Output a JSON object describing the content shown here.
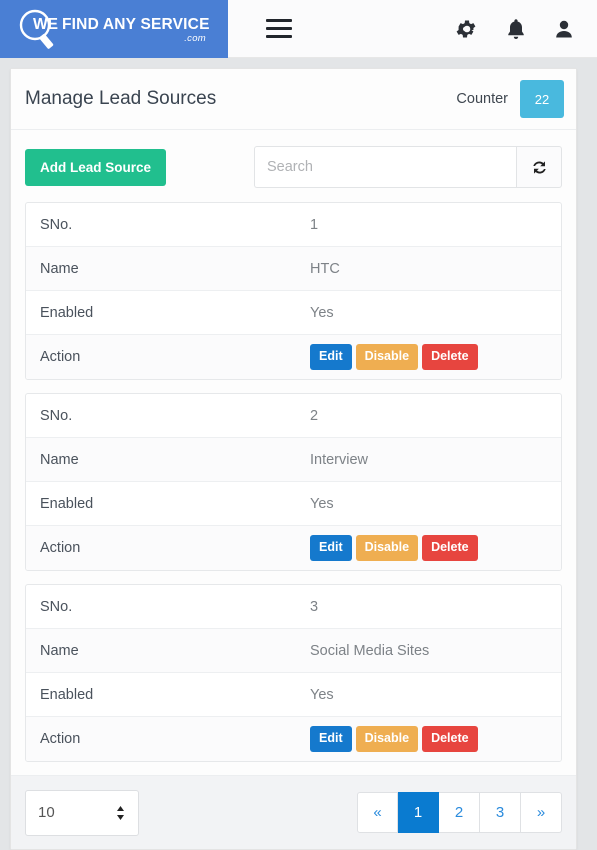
{
  "navbar": {
    "brand": {
      "we": "WE",
      "text": "FIND ANY SERVICE",
      "dotcom": ".com",
      "logo_icon": "magnifier-icon"
    },
    "menu_toggle_icon": "hamburger-icon",
    "icons": [
      {
        "name": "gear-icon",
        "label": "Settings"
      },
      {
        "name": "bell-icon",
        "label": "Notifications"
      },
      {
        "name": "user-icon",
        "label": "Account"
      }
    ]
  },
  "header": {
    "title": "Manage Lead Sources",
    "counter_label": "Counter",
    "counter_value": "22",
    "counter_color": "#49b9de"
  },
  "toolbar": {
    "add_label": "Add Lead Source",
    "add_color": "#21bf8e",
    "search_value": "",
    "search_placeholder": "Search",
    "refresh_icon": "refresh-icon"
  },
  "record_labels": {
    "sno": "SNo.",
    "name": "Name",
    "enabled": "Enabled",
    "action": "Action"
  },
  "actions": {
    "edit": "Edit",
    "disable": "Disable",
    "delete": "Delete",
    "edit_color": "#1579cd",
    "disable_color": "#efae51",
    "delete_color": "#e7453f"
  },
  "records": [
    {
      "sno": "1",
      "name": "HTC",
      "enabled": "Yes"
    },
    {
      "sno": "2",
      "name": "Interview",
      "enabled": "Yes"
    },
    {
      "sno": "3",
      "name": "Social Media Sites",
      "enabled": "Yes"
    }
  ],
  "footer": {
    "page_size": "10",
    "spinner_icon": "spinner-updown-icon",
    "pagination": [
      {
        "label": "«",
        "name": "pagination-prev",
        "active": false
      },
      {
        "label": "1",
        "name": "pagination-page-1",
        "active": true
      },
      {
        "label": "2",
        "name": "pagination-page-2",
        "active": false
      },
      {
        "label": "3",
        "name": "pagination-page-3",
        "active": false
      },
      {
        "label": "»",
        "name": "pagination-next",
        "active": false
      }
    ]
  }
}
